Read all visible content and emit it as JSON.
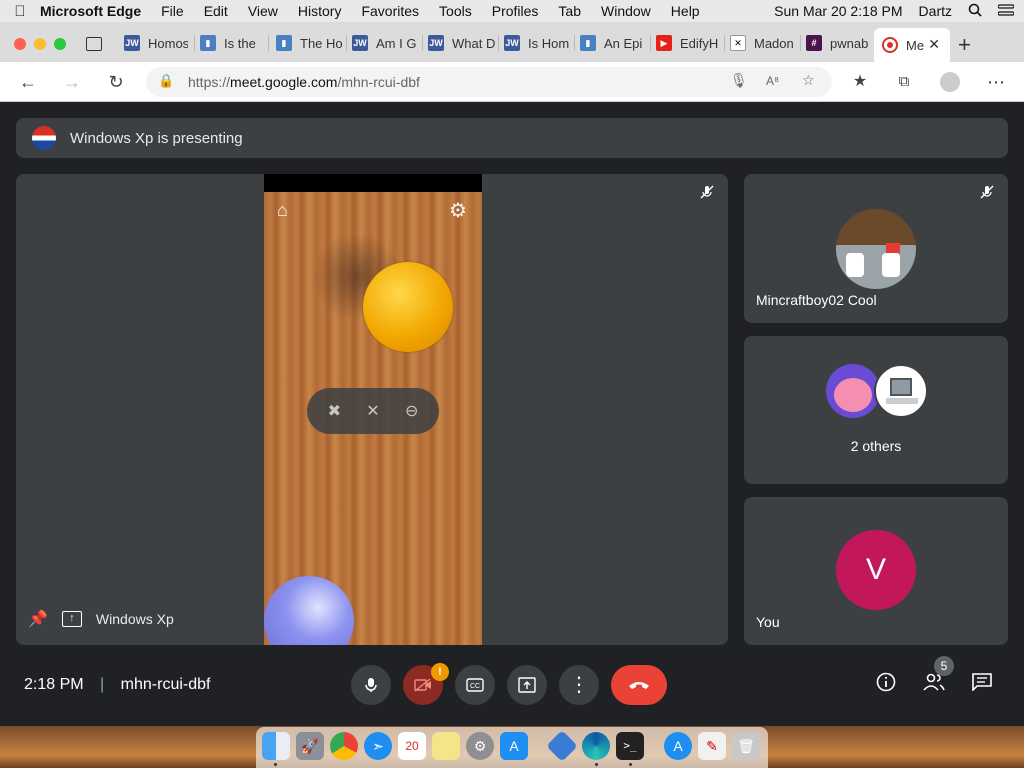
{
  "menubar": {
    "app_name": "Microsoft Edge",
    "items": [
      "File",
      "Edit",
      "View",
      "History",
      "Favorites",
      "Tools",
      "Profiles",
      "Tab",
      "Window",
      "Help"
    ],
    "clock": "Sun Mar 20  2:18 PM",
    "user": "Dartz"
  },
  "tabs": [
    {
      "label": "Homos",
      "icon": "jw-icon"
    },
    {
      "label": "Is the",
      "icon": "bookmark-icon"
    },
    {
      "label": "The Ho",
      "icon": "bookmark-icon"
    },
    {
      "label": "Am I G",
      "icon": "jw-icon"
    },
    {
      "label": "What D",
      "icon": "jw-icon"
    },
    {
      "label": "Is Hom",
      "icon": "jw-icon"
    },
    {
      "label": "An Epi",
      "icon": "bookmark-icon"
    },
    {
      "label": "EdifyH",
      "icon": "youtube-icon"
    },
    {
      "label": "Madon",
      "icon": "x-icon"
    },
    {
      "label": "pwnab",
      "icon": "hash-icon"
    },
    {
      "label": "Me",
      "icon": "record-icon",
      "active": true
    }
  ],
  "address": {
    "url_prefix": "https://",
    "url_domain": "meet.google.com",
    "url_path": "/mhn-rcui-dbf"
  },
  "meet": {
    "presenting_text": "Windows Xp is presenting",
    "presenter_name": "Windows Xp",
    "participants": [
      {
        "name": "Mincraftboy02 Cool"
      },
      {
        "name": "2 others"
      },
      {
        "name": "You",
        "avatar_letter": "V"
      }
    ],
    "time": "2:18 PM",
    "meeting_code": "mhn-rcui-dbf",
    "people_count": "5",
    "camera_alert": "!"
  },
  "colors": {
    "background": "#202124",
    "tile": "#3c4043",
    "end_call": "#ea4335",
    "camera_off": "#8c2b23",
    "you_avatar": "#c2185b",
    "alert": "#f29900"
  }
}
